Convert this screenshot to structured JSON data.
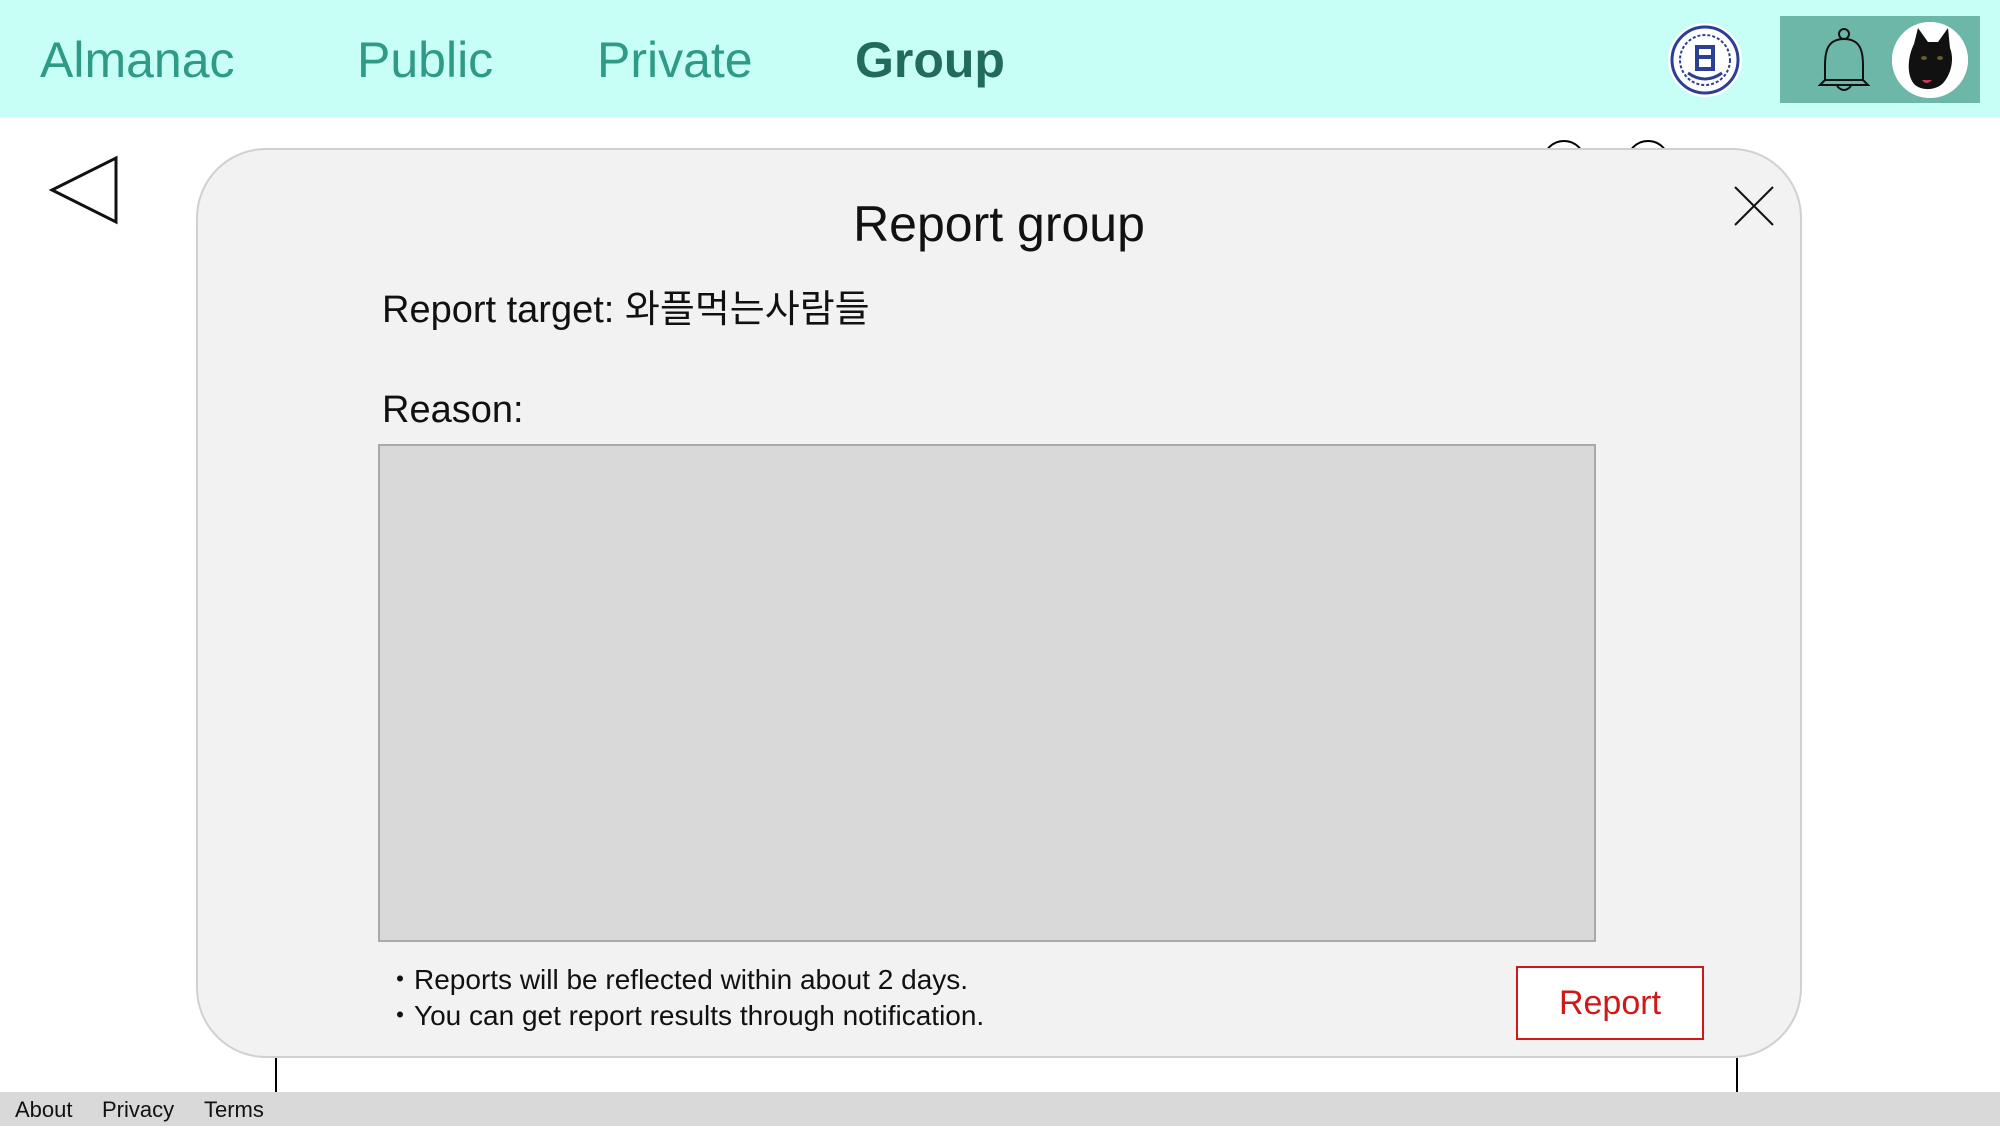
{
  "nav": {
    "brand": "Almanac",
    "items": [
      {
        "label": "Public",
        "active": false
      },
      {
        "label": "Private",
        "active": false
      },
      {
        "label": "Group",
        "active": true
      }
    ]
  },
  "header": {
    "logo_icon": "university-seal-icon",
    "bell_icon": "bell-icon",
    "avatar_icon": "black-cat-avatar"
  },
  "back_icon": "back-triangle-icon",
  "modal": {
    "title": "Report group",
    "target_prefix": "Report target: ",
    "target_name": "와플먹는사람들",
    "reason_label": "Reason:",
    "reason_value": "",
    "notes": [
      "・Reports will be reflected within about 2 days.",
      "・You can get report results through notification."
    ],
    "report_button": "Report",
    "close_icon": "close-x-icon"
  },
  "footer": {
    "links": [
      "About",
      "Privacy",
      "Terms"
    ]
  },
  "colors": {
    "topbar": "#c7fff7",
    "nav_text": "#2f9a86",
    "nav_active": "#216b5b",
    "header_box": "#6cb7a7",
    "modal_bg": "#f2f2f2",
    "input_bg": "#d9d9d9",
    "report_red": "#d01818",
    "footer_bg": "#d9d9d9"
  }
}
